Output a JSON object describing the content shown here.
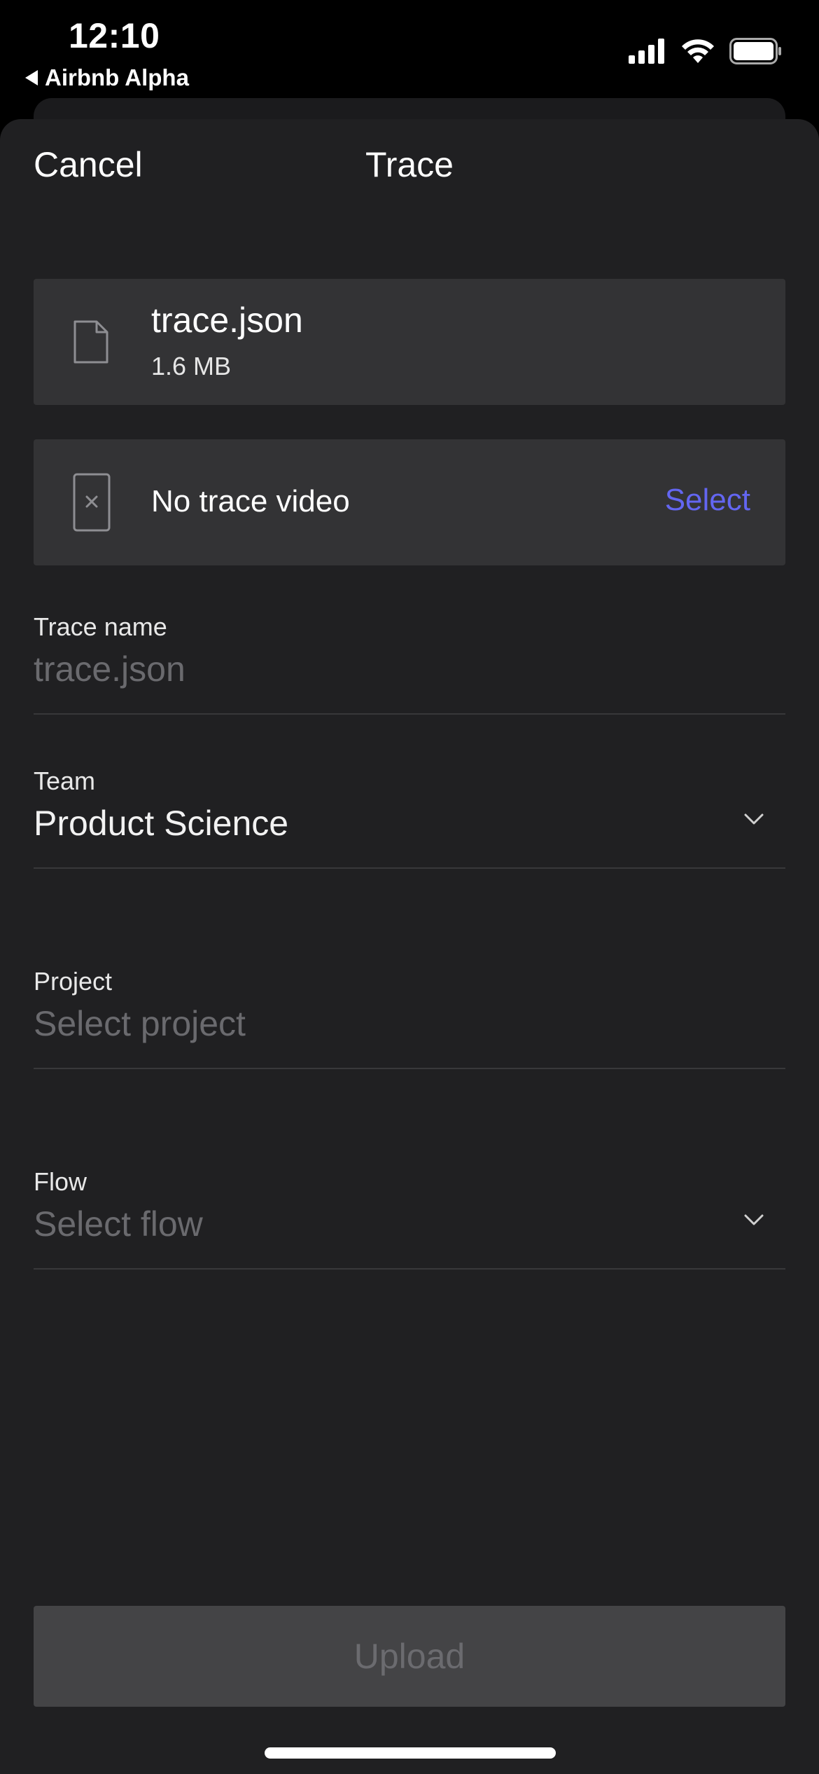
{
  "status_bar": {
    "time": "12:10",
    "back_app": "Airbnb Alpha",
    "icons": [
      "signal-icon",
      "wifi-icon",
      "battery-icon"
    ]
  },
  "nav": {
    "cancel_label": "Cancel",
    "title": "Trace"
  },
  "trace_file": {
    "icon": "file-icon",
    "name": "trace.json",
    "size": "1.6 MB"
  },
  "trace_video": {
    "icon": "no-video-icon",
    "text": "No trace video",
    "select_label": "Select"
  },
  "form": {
    "trace_name": {
      "label": "Trace name",
      "placeholder": "trace.json"
    },
    "team": {
      "label": "Team",
      "value": "Product Science"
    },
    "project": {
      "label": "Project",
      "placeholder": "Select project"
    },
    "flow": {
      "label": "Flow",
      "placeholder": "Select flow"
    }
  },
  "upload_label": "Upload",
  "colors": {
    "accent": "#6366f1",
    "sheet_bg": "#202022",
    "card_bg": "#333335",
    "placeholder": "#6a6a6e",
    "button_disabled_bg": "#444446"
  }
}
